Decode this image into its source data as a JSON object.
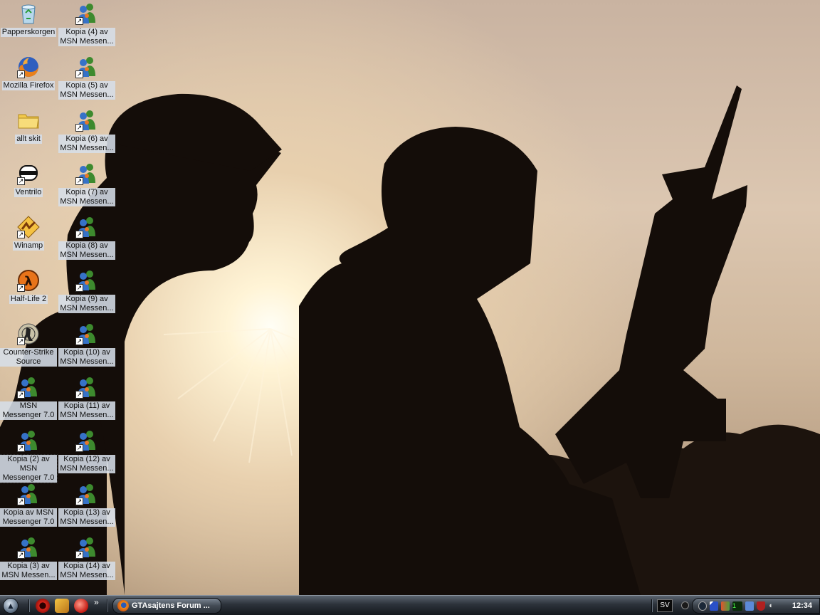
{
  "desktop": {
    "column1": [
      {
        "label": "Papperskorgen",
        "icon": "recycle-bin-icon",
        "shortcut": false
      },
      {
        "label": "Mozilla Firefox",
        "icon": "firefox-icon",
        "shortcut": true
      },
      {
        "label": "allt skit",
        "icon": "folder-icon",
        "shortcut": false
      },
      {
        "label": "Ventrilo",
        "icon": "ventrilo-icon",
        "shortcut": true
      },
      {
        "label": "Winamp",
        "icon": "winamp-icon",
        "shortcut": true
      },
      {
        "label": "Half-Life 2",
        "icon": "half-life-2-icon",
        "shortcut": true
      },
      {
        "label": "Counter-Strike Source",
        "icon": "counter-strike-icon",
        "shortcut": true
      },
      {
        "label": "MSN Messenger 7.0",
        "icon": "msn-messenger-icon",
        "shortcut": true
      },
      {
        "label": "Kopia (2) av MSN Messenger 7.0",
        "icon": "msn-messenger-icon",
        "shortcut": true,
        "selected": true
      },
      {
        "label": "Kopia av MSN Messenger 7.0",
        "icon": "msn-messenger-icon",
        "shortcut": true
      },
      {
        "label": "Kopia (3) av MSN Messen...",
        "icon": "msn-messenger-icon",
        "shortcut": true
      }
    ],
    "column2": [
      {
        "label": "Kopia (4) av MSN Messen...",
        "icon": "msn-messenger-icon",
        "shortcut": true
      },
      {
        "label": "Kopia (5) av MSN Messen...",
        "icon": "msn-messenger-icon",
        "shortcut": true
      },
      {
        "label": "Kopia (6) av MSN Messen...",
        "icon": "msn-messenger-icon",
        "shortcut": true
      },
      {
        "label": "Kopia (7) av MSN Messen...",
        "icon": "msn-messenger-icon",
        "shortcut": true
      },
      {
        "label": "Kopia (8) av MSN Messen...",
        "icon": "msn-messenger-icon",
        "shortcut": true
      },
      {
        "label": "Kopia (9) av MSN Messen...",
        "icon": "msn-messenger-icon",
        "shortcut": true
      },
      {
        "label": "Kopia (10) av MSN Messen...",
        "icon": "msn-messenger-icon",
        "shortcut": true
      },
      {
        "label": "Kopia (11) av MSN Messen...",
        "icon": "msn-messenger-icon",
        "shortcut": true
      },
      {
        "label": "Kopia (12) av MSN Messen...",
        "icon": "msn-messenger-icon",
        "shortcut": true
      },
      {
        "label": "Kopia (13) av MSN Messen...",
        "icon": "msn-messenger-icon",
        "shortcut": true
      },
      {
        "label": "Kopia (14) av MSN Messen...",
        "icon": "msn-messenger-icon",
        "shortcut": true
      }
    ]
  },
  "taskbar": {
    "start_glyph": "▲",
    "chevron": "»",
    "task_title": "GTAsajtens Forum ...",
    "language": "SV",
    "clock": "12:34",
    "shortcut_arrow": "↗"
  },
  "colors": {
    "label_bg": "#d6dee8",
    "silhouette": "#140d09",
    "taskbar": "#2c323a"
  }
}
